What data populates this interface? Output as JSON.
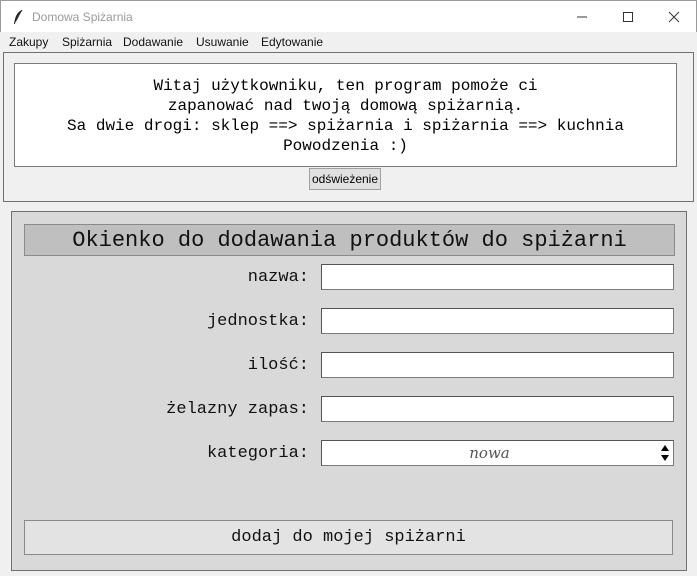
{
  "window": {
    "title": "Domowa Spiżarnia",
    "icon": "feather-icon"
  },
  "menu": {
    "items": [
      {
        "label": "Zakupy"
      },
      {
        "label": "Spiżarnia"
      },
      {
        "label": "Dodawanie"
      },
      {
        "label": "Usuwanie"
      },
      {
        "label": "Edytowanie"
      }
    ]
  },
  "welcome": {
    "lines": [
      "Witaj użytkowniku, ten program pomoże ci",
      "zapanować nad twoją domową spiżarnią.",
      "Sa dwie drogi: sklep ==> spiżarnia i spiżarnia ==> kuchnia",
      "Powodzenia :)"
    ],
    "refresh_label": "odświeżenie"
  },
  "form": {
    "header": "Okienko do dodawania produktów do spiżarni",
    "fields": [
      {
        "label": "nazwa:",
        "value": ""
      },
      {
        "label": "jednostka:",
        "value": ""
      },
      {
        "label": "ilość:",
        "value": ""
      },
      {
        "label": "żelazny zapas:",
        "value": ""
      },
      {
        "label": "kategoria:",
        "value": "nowa"
      }
    ],
    "submit_label": "dodaj do mojej spiżarni"
  },
  "colors": {
    "window_bg": "#f0f0f0",
    "form_bg": "#d9d9d9",
    "header_bg": "#bfbfbf"
  }
}
